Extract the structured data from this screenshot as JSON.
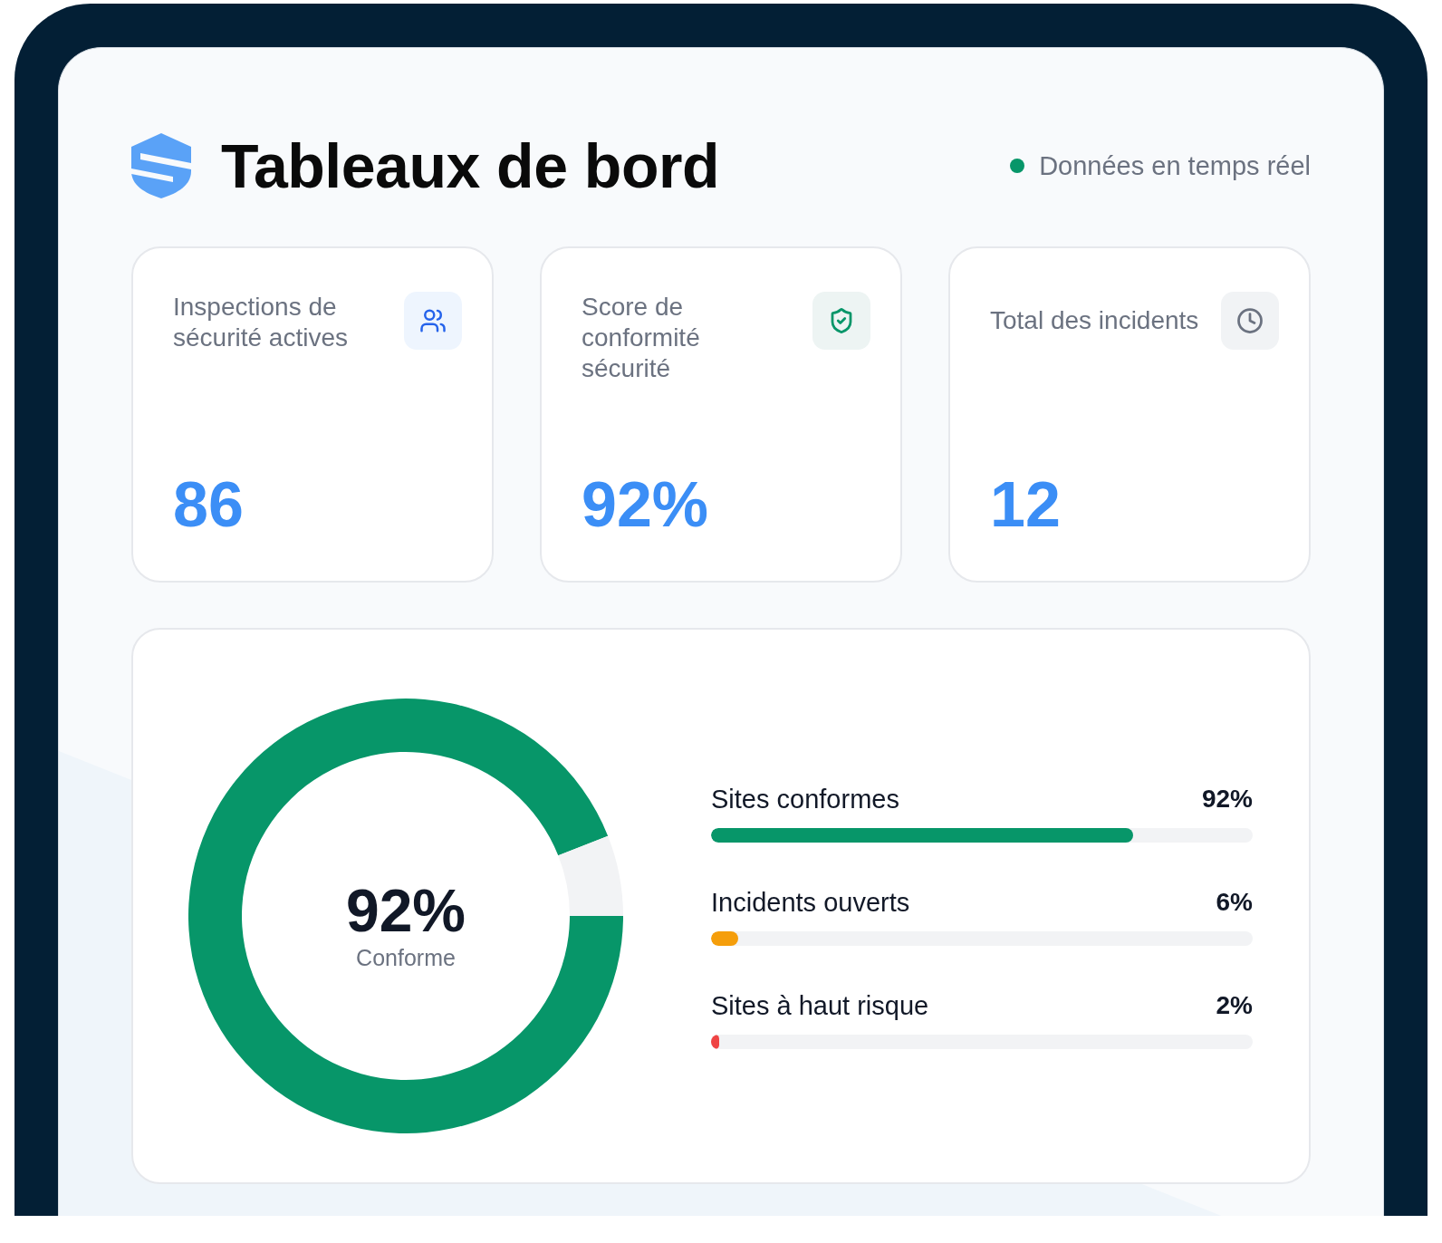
{
  "header": {
    "title": "Tableaux de bord",
    "status": {
      "label": "Données en temps réel",
      "live": true
    }
  },
  "stats": [
    {
      "label": "Inspections de sécurité actives",
      "value": "86"
    },
    {
      "label": "Score de conformité sécurité",
      "value": "92%"
    },
    {
      "label": "Total des incidents",
      "value": "12"
    }
  ],
  "compliance": {
    "ring": {
      "value": "92%",
      "caption": "Conforme",
      "chart_data": {
        "type": "donut",
        "values": [
          94,
          6
        ]
      }
    },
    "bars": [
      {
        "label": "Sites conformes",
        "value": "92%",
        "level": 0.78,
        "color": "#079669"
      },
      {
        "label": "Incidents ouverts",
        "value": "6%",
        "level": 0.05,
        "color": "#f59e0b"
      },
      {
        "label": "Sites à haut risque",
        "value": "2%",
        "level": 0.015,
        "color": "#ef4444"
      }
    ]
  }
}
